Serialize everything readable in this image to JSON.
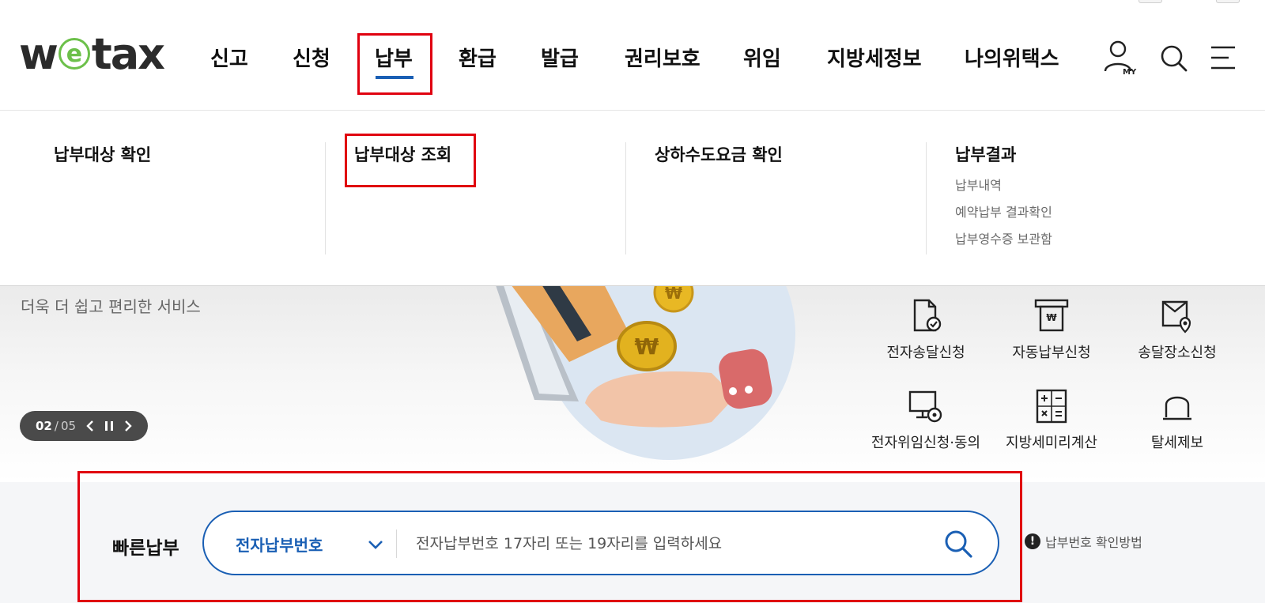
{
  "logo": {
    "text_pre": "w",
    "text_e": "e",
    "text_post": "tax"
  },
  "gnb": {
    "items": [
      "신고",
      "신청",
      "납부",
      "환급",
      "발급",
      "권리보호",
      "위임",
      "지방세정보",
      "나의위택스"
    ],
    "active": "납부"
  },
  "utility": {
    "my_label": "MY",
    "icons": [
      "my-page-icon",
      "search-icon",
      "menu-icon"
    ]
  },
  "megamenu": {
    "columns": [
      {
        "heading": "납부대상 확인",
        "items": []
      },
      {
        "heading": "납부대상 조회",
        "items": []
      },
      {
        "heading": "상하수도요금 확인",
        "items": []
      },
      {
        "heading": "납부결과",
        "items": [
          "납부내역",
          "예약납부 결과확인",
          "납부영수증 보관함"
        ]
      }
    ]
  },
  "hero": {
    "subtitle": "더욱 더 쉽고 편리한 서비스",
    "slider": {
      "current": "02",
      "separator": "/",
      "total": "05"
    },
    "quick_links": [
      {
        "label": "전자송달신청",
        "icon": "document-check-icon"
      },
      {
        "label": "자동납부신청",
        "icon": "auto-payment-icon"
      },
      {
        "label": "송달장소신청",
        "icon": "delivery-location-icon"
      },
      {
        "label": "전자위임신청·동의",
        "icon": "monitor-delegate-icon"
      },
      {
        "label": "지방세미리계산",
        "icon": "calculator-icon"
      },
      {
        "label": "탈세제보",
        "icon": "alarm-bell-icon"
      }
    ]
  },
  "quickpay": {
    "title": "빠른납부",
    "select_value": "전자납부번호",
    "placeholder": "전자납부번호 17자리 또는 19자리를 입력하세요",
    "help_label": "납부번호 확인방법"
  },
  "colors": {
    "accent": "#1a5fb4",
    "highlight": "#e0000f",
    "logo_green": "#6cc04a"
  }
}
